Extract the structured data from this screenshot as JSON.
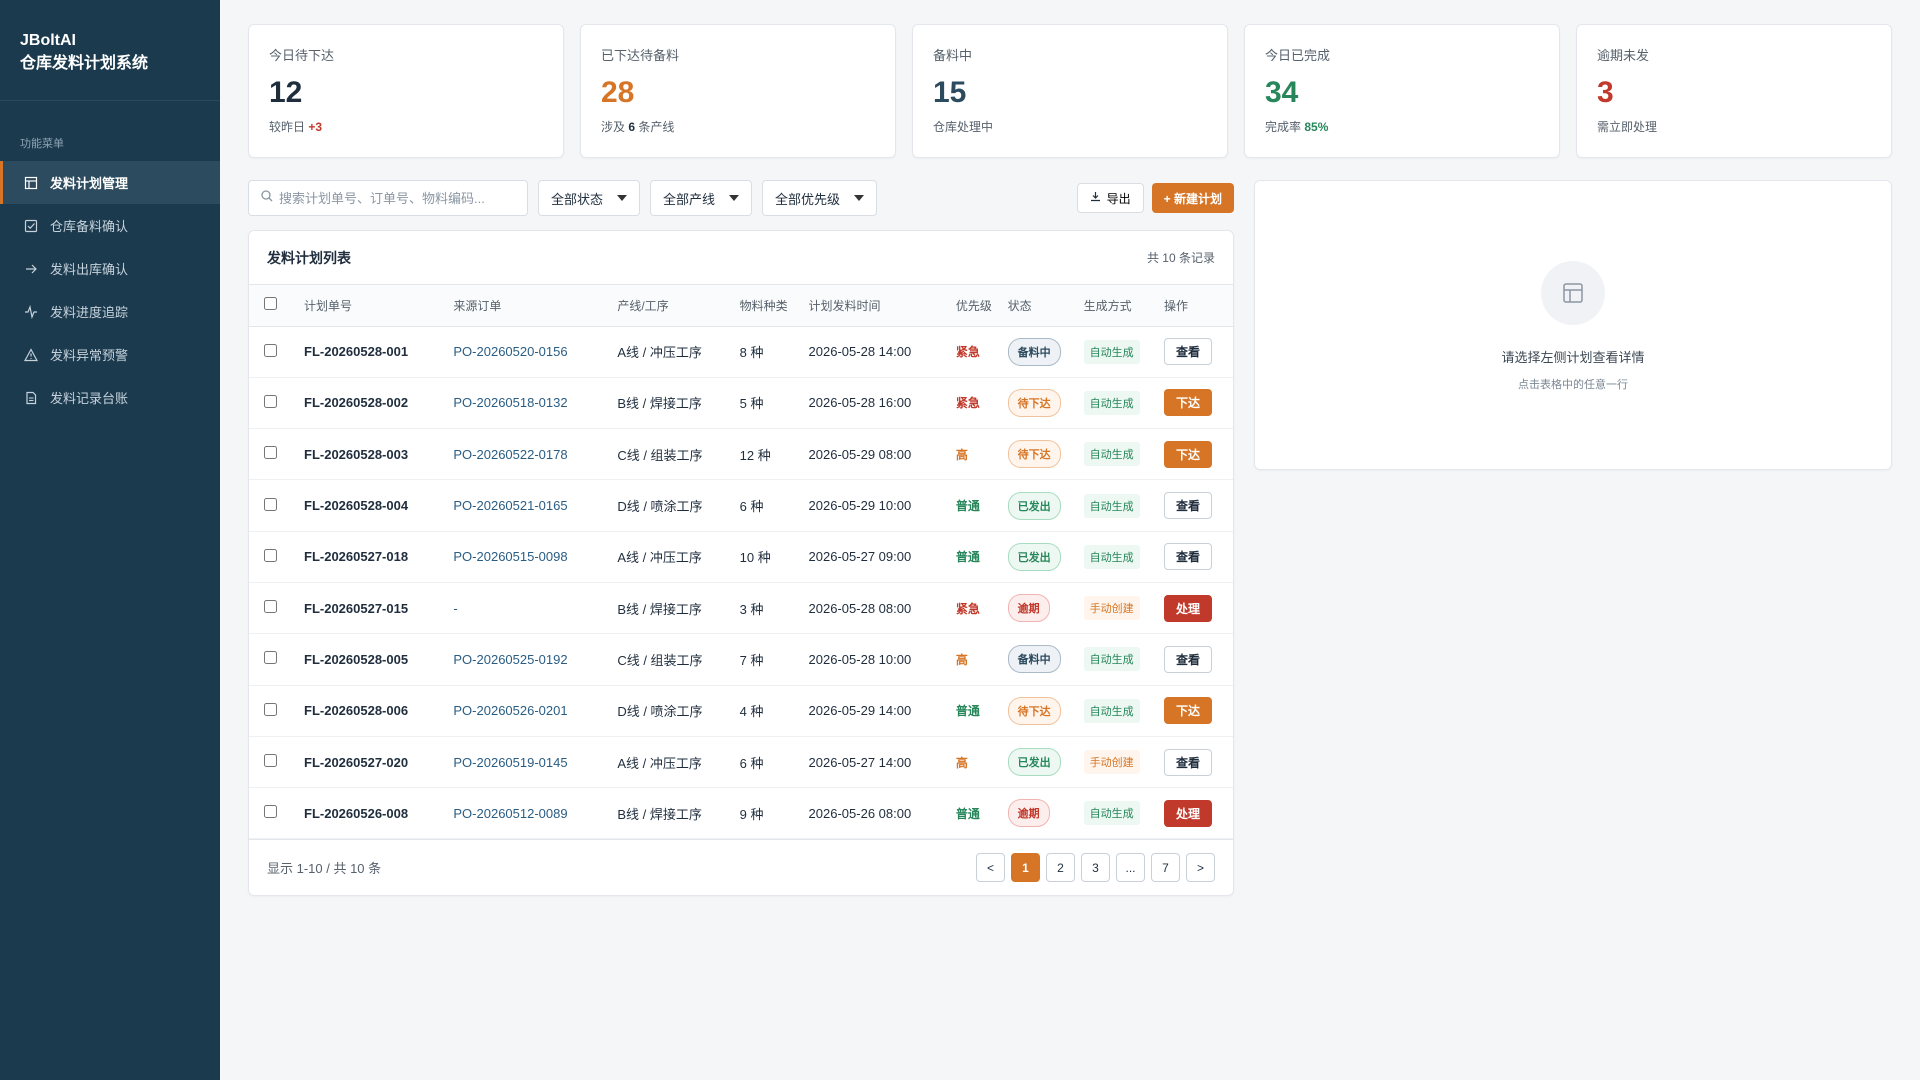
{
  "brand": {
    "line1": "JBoltAI",
    "line2": "仓库发料计划系统"
  },
  "sidebar": {
    "section_title": "功能菜单",
    "items": [
      {
        "label": "发料计划管理",
        "icon": "table-icon",
        "active": true
      },
      {
        "label": "仓库备料确认",
        "icon": "checkbox-icon",
        "active": false
      },
      {
        "label": "发料出库确认",
        "icon": "arrow-right-icon",
        "active": false
      },
      {
        "label": "发料进度追踪",
        "icon": "activity-icon",
        "active": false
      },
      {
        "label": "发料异常预警",
        "icon": "warning-icon",
        "active": false
      },
      {
        "label": "发料记录台账",
        "icon": "document-icon",
        "active": false
      }
    ]
  },
  "stats": [
    {
      "label": "今日待下达",
      "value": "12",
      "value_color": "#1f2d3d",
      "sub_prefix": "较昨日 ",
      "sub_strong": "+3",
      "sub_suffix": "",
      "sub_strong_color": "#c0392b"
    },
    {
      "label": "已下达待备料",
      "value": "28",
      "value_color": "#d67526",
      "sub_prefix": "涉及 ",
      "sub_strong": "6",
      "sub_suffix": " 条产线",
      "sub_strong_color": "#1f2d3d"
    },
    {
      "label": "备料中",
      "value": "15",
      "value_color": "#2c4b5f",
      "sub_prefix": "仓库处理中",
      "sub_strong": "",
      "sub_suffix": "",
      "sub_strong_color": "#1f2d3d"
    },
    {
      "label": "今日已完成",
      "value": "34",
      "value_color": "#27865a",
      "sub_prefix": "完成率 ",
      "sub_strong": "85%",
      "sub_suffix": "",
      "sub_strong_color": "#27865a"
    },
    {
      "label": "逾期未发",
      "value": "3",
      "value_color": "#c0392b",
      "sub_prefix": "需立即处理",
      "sub_strong": "",
      "sub_suffix": "",
      "sub_strong_color": "#1f2d3d"
    }
  ],
  "toolbar": {
    "search_placeholder": "搜索计划单号、订单号、物料编码...",
    "filter_status": "全部状态",
    "filter_line": "全部产线",
    "filter_priority": "全部优先级",
    "export_label": "导出",
    "new_label": "+ 新建计划"
  },
  "table": {
    "title": "发料计划列表",
    "count": "共 10 条记录",
    "columns": [
      "计划单号",
      "来源订单",
      "产线/工序",
      "物料种类",
      "计划发料时间",
      "优先级",
      "状态",
      "生成方式",
      "操作"
    ],
    "rows": [
      {
        "plan": "FL-20260528-001",
        "order": "PO-20260520-0156",
        "line": "A线 / 冲压工序",
        "kinds": "8 种",
        "time": "2026-05-28 14:00",
        "priority": "紧急",
        "pri_class": "pri-urgent",
        "status": "备料中",
        "st_class": "st-prep",
        "gen": "自动生成",
        "gen_class": "gen-auto",
        "action": "查看",
        "act_class": "act-view"
      },
      {
        "plan": "FL-20260528-002",
        "order": "PO-20260518-0132",
        "line": "B线 / 焊接工序",
        "kinds": "5 种",
        "time": "2026-05-28 16:00",
        "priority": "紧急",
        "pri_class": "pri-urgent",
        "status": "待下达",
        "st_class": "st-pending",
        "gen": "自动生成",
        "gen_class": "gen-auto",
        "action": "下达",
        "act_class": "act-issue"
      },
      {
        "plan": "FL-20260528-003",
        "order": "PO-20260522-0178",
        "line": "C线 / 组装工序",
        "kinds": "12 种",
        "time": "2026-05-29 08:00",
        "priority": "高",
        "pri_class": "pri-high",
        "status": "待下达",
        "st_class": "st-pending",
        "gen": "自动生成",
        "gen_class": "gen-auto",
        "action": "下达",
        "act_class": "act-issue"
      },
      {
        "plan": "FL-20260528-004",
        "order": "PO-20260521-0165",
        "line": "D线 / 喷涂工序",
        "kinds": "6 种",
        "time": "2026-05-29 10:00",
        "priority": "普通",
        "pri_class": "pri-normal",
        "status": "已发出",
        "st_class": "st-shipped",
        "gen": "自动生成",
        "gen_class": "gen-auto",
        "action": "查看",
        "act_class": "act-view"
      },
      {
        "plan": "FL-20260527-018",
        "order": "PO-20260515-0098",
        "line": "A线 / 冲压工序",
        "kinds": "10 种",
        "time": "2026-05-27 09:00",
        "priority": "普通",
        "pri_class": "pri-normal",
        "status": "已发出",
        "st_class": "st-shipped",
        "gen": "自动生成",
        "gen_class": "gen-auto",
        "action": "查看",
        "act_class": "act-view"
      },
      {
        "plan": "FL-20260527-015",
        "order": "-",
        "line": "B线 / 焊接工序",
        "kinds": "3 种",
        "time": "2026-05-28 08:00",
        "priority": "紧急",
        "pri_class": "pri-urgent",
        "status": "逾期",
        "st_class": "st-overdue",
        "gen": "手动创建",
        "gen_class": "gen-manual",
        "action": "处理",
        "act_class": "act-handle"
      },
      {
        "plan": "FL-20260528-005",
        "order": "PO-20260525-0192",
        "line": "C线 / 组装工序",
        "kinds": "7 种",
        "time": "2026-05-28 10:00",
        "priority": "高",
        "pri_class": "pri-high",
        "status": "备料中",
        "st_class": "st-prep",
        "gen": "自动生成",
        "gen_class": "gen-auto",
        "action": "查看",
        "act_class": "act-view"
      },
      {
        "plan": "FL-20260528-006",
        "order": "PO-20260526-0201",
        "line": "D线 / 喷涂工序",
        "kinds": "4 种",
        "time": "2026-05-29 14:00",
        "priority": "普通",
        "pri_class": "pri-normal",
        "status": "待下达",
        "st_class": "st-pending",
        "gen": "自动生成",
        "gen_class": "gen-auto",
        "action": "下达",
        "act_class": "act-issue"
      },
      {
        "plan": "FL-20260527-020",
        "order": "PO-20260519-0145",
        "line": "A线 / 冲压工序",
        "kinds": "6 种",
        "time": "2026-05-27 14:00",
        "priority": "高",
        "pri_class": "pri-high",
        "status": "已发出",
        "st_class": "st-shipped",
        "gen": "手动创建",
        "gen_class": "gen-manual",
        "action": "查看",
        "act_class": "act-view"
      },
      {
        "plan": "FL-20260526-008",
        "order": "PO-20260512-0089",
        "line": "B线 / 焊接工序",
        "kinds": "9 种",
        "time": "2026-05-26 08:00",
        "priority": "普通",
        "pri_class": "pri-normal",
        "status": "逾期",
        "st_class": "st-overdue",
        "gen": "自动生成",
        "gen_class": "gen-auto",
        "action": "处理",
        "act_class": "act-handle"
      }
    ],
    "footer_info": "显示 1-10 / 共 10 条",
    "pager": [
      {
        "label": "<",
        "active": false
      },
      {
        "label": "1",
        "active": true
      },
      {
        "label": "2",
        "active": false
      },
      {
        "label": "3",
        "active": false
      },
      {
        "label": "...",
        "active": false
      },
      {
        "label": "7",
        "active": false
      },
      {
        "label": ">",
        "active": false
      }
    ]
  },
  "detail": {
    "icon": "layout-icon",
    "message": "请选择左侧计划查看详情",
    "hint": "点击表格中的任意一行"
  },
  "colors": {
    "accent": "#d67526",
    "sidebar_bg": "#1c3a4e",
    "danger": "#c0392b",
    "success": "#27865a"
  }
}
